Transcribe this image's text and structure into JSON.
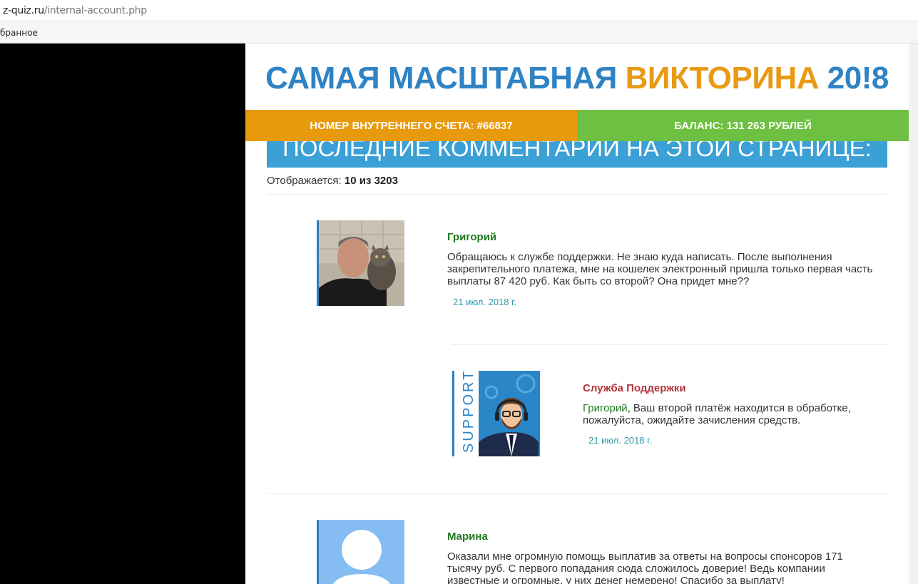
{
  "browser": {
    "url_host": "z-quiz.ru",
    "url_path": "/internal-account.php",
    "bookmark_label": "бранное"
  },
  "header": {
    "title_part1": "САМАЯ МАСШТАБНАЯ ",
    "title_part2": "ВИКТОРИНА",
    "title_part3": " 20!8"
  },
  "account": {
    "number_label": "НОМЕР ВНУТРЕННЕГО СЧЕТА: #66837",
    "balance_label": "БАЛАНС: 131 263 РУБЛЕЙ"
  },
  "comments": {
    "banner": "ПОСЛЕДНИЕ КОММЕНТАРИИ НА ЭТОЙ СТРАНИЦЕ:",
    "shown_prefix": "Отображается: ",
    "shown_count": "10 из 3203",
    "items": [
      {
        "author": "Григорий",
        "text": "Обращаюсь к службе поддержки. Не знаю куда написать. После выполнения закрепительного платежа, мне на кошелек электронный пришла только первая часть выплаты 87 420 руб. Как быть со второй? Она придет мне??",
        "date": "21 июл. 2018 г."
      },
      {
        "author": "Служба Поддержки",
        "mention": "Григорий",
        "text": ", Ваш второй платёж находится в обработке, пожалуйста, ожидайте зачисления средств.",
        "date": "21 июл. 2018 г.",
        "avatar_caption": "SUPPORT"
      },
      {
        "author": "Марина",
        "text": "Оказали мне огромную помощь выплатив за ответы на вопросы спонсоров 171 тысячу руб. С первого попадания сюда сложилось доверие! Ведь компании известные и огромные, у них денег немерено! Спасибо за выплату!"
      }
    ]
  },
  "colors": {
    "title_blue": "#2f83c4",
    "title_orange": "#e89a14",
    "account_orange": "#e89a0e",
    "balance_green": "#6ec042",
    "banner_blue": "#3aa0d6",
    "author_green": "#1f7a1f",
    "support_red": "#b3343c",
    "date_teal": "#2a9aa6"
  }
}
